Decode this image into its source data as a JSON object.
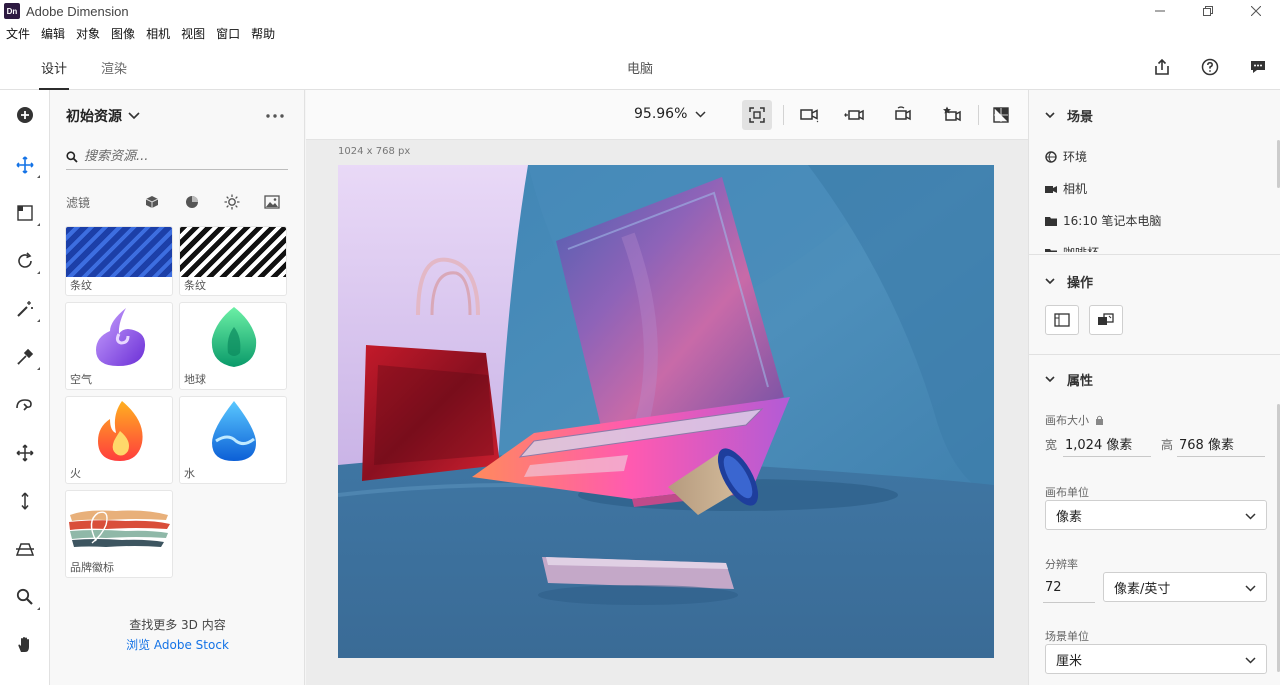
{
  "window": {
    "title": "Adobe Dimension",
    "logo_text": "Dn"
  },
  "menu": [
    "文件",
    "编辑",
    "对象",
    "图像",
    "相机",
    "视图",
    "窗口",
    "帮助"
  ],
  "nav": {
    "tabs": [
      "设计",
      "渲染"
    ],
    "active_tab": "设计",
    "doc_title": "电脑",
    "icons": [
      "share-icon",
      "help-icon",
      "feedback-icon"
    ]
  },
  "tools": [
    "add-icon",
    "select-icon",
    "marquee-icon",
    "rotate-icon",
    "magic-wand-icon",
    "eyedropper-icon",
    "sample-icon",
    "move-icon",
    "vertical-move-icon",
    "horizon-icon",
    "zoom-icon",
    "hand-icon"
  ],
  "assets": {
    "header": "初始资源",
    "search_placeholder": "搜索资源...",
    "filter_label": "滤镜",
    "filter_icons": [
      "model-filter-icon",
      "material-filter-icon",
      "light-filter-icon",
      "image-filter-icon"
    ],
    "items": [
      {
        "label": "条纹",
        "thumb": "stripes-blue"
      },
      {
        "label": "条纹",
        "thumb": "stripes-black"
      },
      {
        "label": "空气",
        "thumb": "air-swirl"
      },
      {
        "label": "地球",
        "thumb": "earth-leaf"
      },
      {
        "label": "火",
        "thumb": "fire-flame"
      },
      {
        "label": "水",
        "thumb": "water-drop"
      },
      {
        "label": "品牌徽标",
        "thumb": "brand-logo"
      }
    ],
    "footer_text": "查找更多 3D 内容",
    "footer_link": "浏览 Adobe Stock"
  },
  "canvas": {
    "zoom": "95.96%",
    "size_label": "1024 x 768 px"
  },
  "scene": {
    "title": "场景",
    "items": [
      {
        "label": "环境",
        "icon": "globe-icon"
      },
      {
        "label": "相机",
        "icon": "camera-icon"
      },
      {
        "label": "16:10 笔记本电脑",
        "icon": "folder-icon"
      },
      {
        "label": "咖啡杯",
        "icon": "folder-icon"
      }
    ]
  },
  "actions": {
    "title": "操作"
  },
  "properties": {
    "title": "属性",
    "canvas_size_label": "画布大小",
    "width_label": "宽",
    "width_value": "1,024 像素",
    "height_label": "高",
    "height_value": "768 像素",
    "canvas_units_label": "画布单位",
    "canvas_units_value": "像素",
    "resolution_label": "分辨率",
    "resolution_value": "72",
    "resolution_unit": "像素/英寸",
    "scene_units_label": "场景单位",
    "scene_units_value": "厘米"
  }
}
